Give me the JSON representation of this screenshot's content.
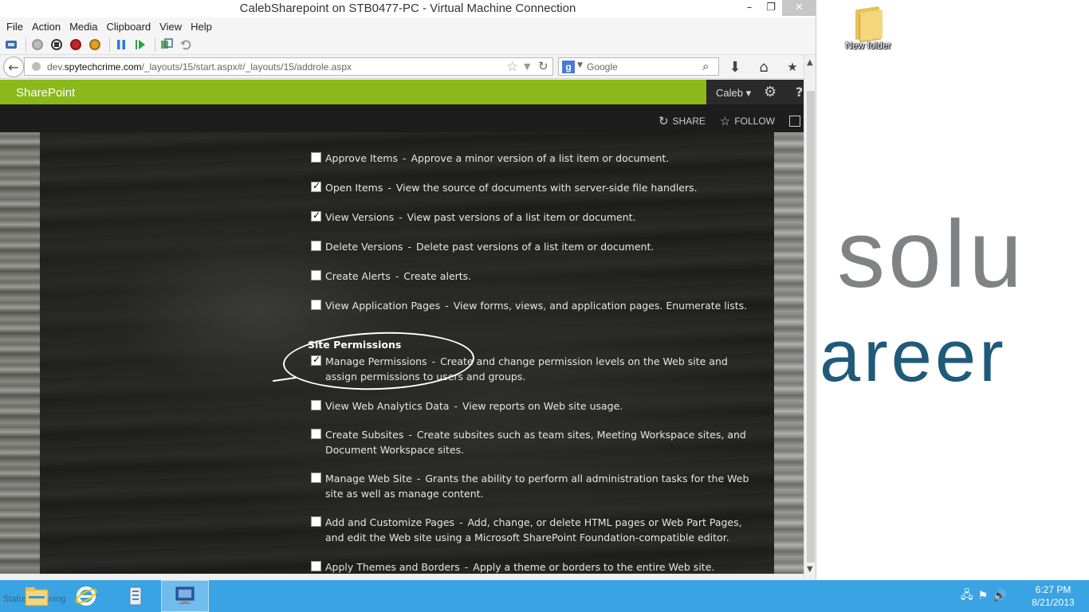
{
  "vm": {
    "title": "CalebSharepoint on STB0477-PC - Virtual Machine Connection",
    "window_buttons": {
      "minimize": "–",
      "maximize": "❐",
      "close": "✕"
    },
    "menu": [
      "File",
      "Action",
      "Media",
      "Clipboard",
      "View",
      "Help"
    ]
  },
  "browser": {
    "url_prefix": "dev.",
    "url_domain": "spytechcrime.com",
    "url_path": "/_layouts/15/start.aspx#/_layouts/15/addrole.aspx",
    "search_placeholder": "Google",
    "search_engine_letter": "g"
  },
  "sharepoint": {
    "brand": "SharePoint",
    "user": "Caleb ▾",
    "actions": {
      "share": "SHARE",
      "follow": "FOLLOW"
    },
    "permissions": [
      {
        "name": "Approve Items",
        "desc": "Approve a minor version of a list item or document.",
        "checked": false
      },
      {
        "name": "Open Items",
        "desc": "View the source of documents with server-side file handlers.",
        "checked": true
      },
      {
        "name": "View Versions",
        "desc": "View past versions of a list item or document.",
        "checked": true
      },
      {
        "name": "Delete Versions",
        "desc": "Delete past versions of a list item or document.",
        "checked": false
      },
      {
        "name": "Create Alerts",
        "desc": "Create alerts.",
        "checked": false
      },
      {
        "name": "View Application Pages",
        "desc": "View forms, views, and application pages. Enumerate lists.",
        "checked": false
      }
    ],
    "site_permissions_heading": "Site Permissions",
    "site_permissions": [
      {
        "name": "Manage Permissions",
        "desc": "Create and change permission levels on the Web site and assign permissions to users and groups.",
        "checked": true
      },
      {
        "name": "View Web Analytics Data",
        "desc": "View reports on Web site usage.",
        "checked": false
      },
      {
        "name": "Create Subsites",
        "desc": "Create subsites such as team sites, Meeting Workspace sites, and Document Workspace sites.",
        "checked": false
      },
      {
        "name": "Manage Web Site",
        "desc": "Grants the ability to perform all administration tasks for the Web site as well as manage content.",
        "checked": false
      },
      {
        "name": "Add and Customize Pages",
        "desc": "Add, change, or delete HTML pages or Web Part Pages, and edit the Web site using a Microsoft SharePoint Foundation-compatible editor.",
        "checked": false
      },
      {
        "name": "Apply Themes and Borders",
        "desc": "Apply a theme or borders to the entire Web site.",
        "checked": false
      }
    ],
    "separator": "-"
  },
  "desktop": {
    "folder_label": "New folder",
    "bg_text_1": "solu",
    "bg_text_2": "areer"
  },
  "taskbar": {
    "status_ghost": "Status: Running",
    "clock_time": "6:27 PM",
    "clock_date": "8/21/2013"
  },
  "colors": {
    "sharepoint_green": "#8ab919",
    "taskbar_blue": "#3aa3e3"
  }
}
